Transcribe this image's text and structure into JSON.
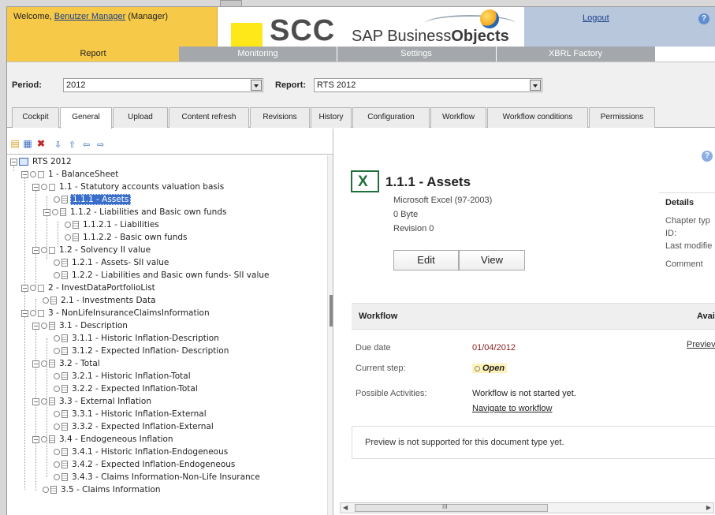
{
  "header": {
    "welcome_prefix": "Welcome, ",
    "user_name": "Benutzer Manager",
    "role": " (Manager)",
    "brand": "SCC",
    "sap_brand_a": "SAP Business",
    "sap_brand_b": "Objects",
    "logout": "Logout",
    "help": "?"
  },
  "nav": {
    "items": [
      {
        "label": "Report"
      },
      {
        "label": "Monitoring"
      },
      {
        "label": "Settings"
      },
      {
        "label": "XBRL Factory"
      }
    ]
  },
  "filter": {
    "period_label": "Period:",
    "period_value": "2012",
    "report_label": "Report:",
    "report_value": "RTS 2012"
  },
  "tabs": [
    {
      "label": "Cockpit"
    },
    {
      "label": "General"
    },
    {
      "label": "Upload"
    },
    {
      "label": "Content refresh"
    },
    {
      "label": "Revisions"
    },
    {
      "label": "History"
    },
    {
      "label": "Configuration"
    },
    {
      "label": "Workflow"
    },
    {
      "label": "Workflow conditions"
    },
    {
      "label": "Permissions"
    }
  ],
  "tree": {
    "root": "RTS 2012",
    "nodes": [
      {
        "label": "1 - BalanceSheet"
      },
      {
        "label": "1.1 - Statutory accounts valuation basis"
      },
      {
        "label": "1.1.1 - Assets"
      },
      {
        "label": "1.1.2 - Liabilities and Basic own funds"
      },
      {
        "label": "1.1.2.1 - Liabilities"
      },
      {
        "label": "1.1.2.2 - Basic own funds"
      },
      {
        "label": "1.2 - Solvency II value"
      },
      {
        "label": "1.2.1 - Assets- SII value"
      },
      {
        "label": "1.2.2 - Liabilities and Basic own funds- SII value"
      },
      {
        "label": "2 - InvestDataPortfolioList"
      },
      {
        "label": "2.1 - Investments Data"
      },
      {
        "label": "3 - NonLifeInsuranceClaimsInformation"
      },
      {
        "label": "3.1 - Description"
      },
      {
        "label": "3.1.1 - Historic Inflation-Description"
      },
      {
        "label": "3.1.2 - Expected Inflation- Description"
      },
      {
        "label": "3.2 - Total"
      },
      {
        "label": "3.2.1 - Historic Inflation-Total"
      },
      {
        "label": "3.2.2 - Expected Inflation-Total"
      },
      {
        "label": "3.3 - External Inflation"
      },
      {
        "label": "3.3.1 - Historic Inflation-External"
      },
      {
        "label": "3.3.2 - Expected Inflation-External"
      },
      {
        "label": "3.4 - Endogeneous Inflation"
      },
      {
        "label": "3.4.1 - Historic Inflation-Endogeneous"
      },
      {
        "label": "3.4.2 - Expected Inflation-Endogeneous"
      },
      {
        "label": "3.4.3 - Claims Information-Non-Life Insurance"
      },
      {
        "label": "3.5 - Claims Information"
      }
    ]
  },
  "document": {
    "title": "1.1.1 - Assets",
    "format": "Microsoft Excel (97-2003)",
    "size": "0 Byte",
    "revision": "Revision 0",
    "edit": "Edit",
    "view": "View"
  },
  "details": {
    "heading": "Details",
    "chapter_type": "Chapter typ",
    "id": "ID:",
    "last_modified": "Last modifie",
    "comment": "Comment"
  },
  "workflow": {
    "heading": "Workflow",
    "available_heading": "Availab",
    "preview_link": "Previev",
    "due_label": "Due date",
    "due_value": "01/04/2012",
    "step_label": "Current step:",
    "step_value": "Open",
    "activities_label": "Possible Activities:",
    "activities_value": "Workflow is not started yet.",
    "navigate_link": "Navigate to workflow"
  },
  "preview": {
    "message": "Preview is not supported for this document type yet."
  },
  "scrollbar": {
    "grip": "III"
  }
}
